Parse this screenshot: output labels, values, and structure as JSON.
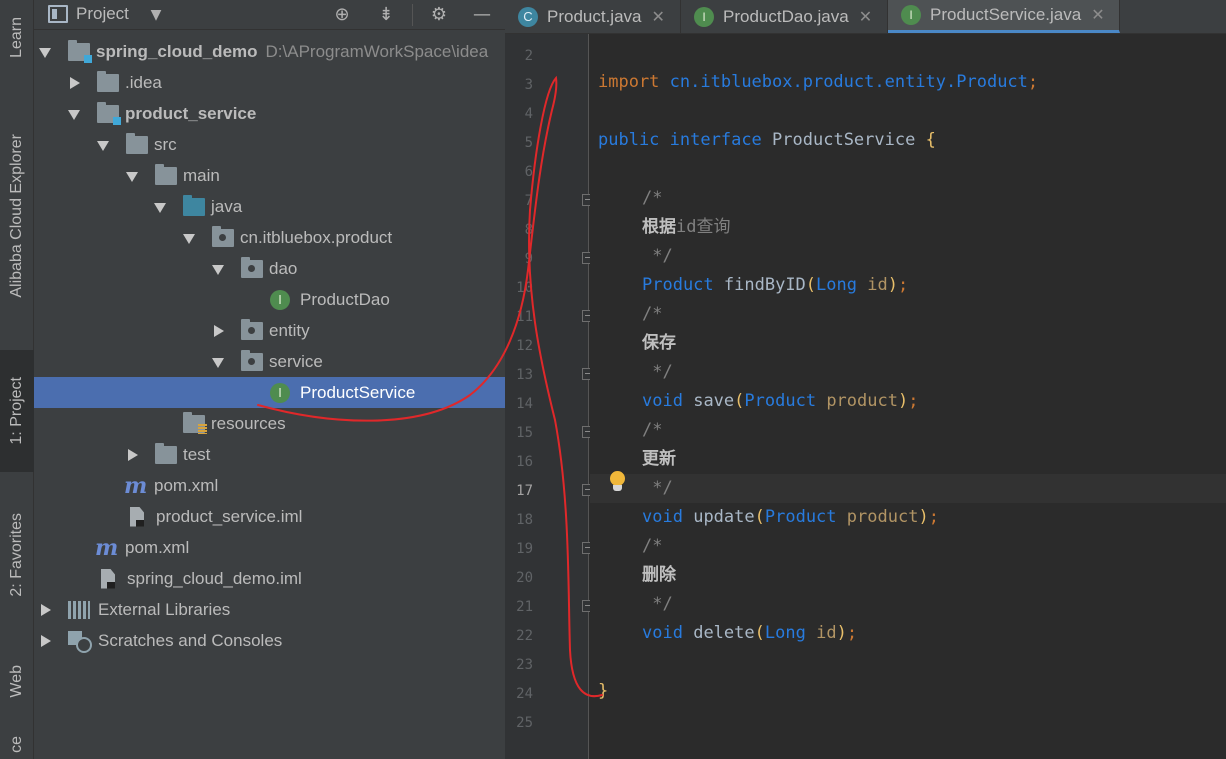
{
  "toolstrip": {
    "learn": "Learn",
    "cloud_explorer": "Alibaba Cloud Explorer",
    "project": "1: Project",
    "favorites": "2: Favorites",
    "web": "Web",
    "bottom_cut": "ce"
  },
  "project_panel": {
    "title": "Project",
    "tree": [
      {
        "label": "spring_cloud_demo",
        "path": "D:\\AProgramWorkSpace\\idea"
      },
      {
        "label": ".idea"
      },
      {
        "label": "product_service"
      },
      {
        "label": "src"
      },
      {
        "label": "main"
      },
      {
        "label": "java"
      },
      {
        "label": "cn.itbluebox.product"
      },
      {
        "label": "dao"
      },
      {
        "label": "ProductDao"
      },
      {
        "label": "entity"
      },
      {
        "label": "service"
      },
      {
        "label": "ProductService"
      },
      {
        "label": "resources"
      },
      {
        "label": "test"
      },
      {
        "label": "pom.xml"
      },
      {
        "label": "product_service.iml"
      },
      {
        "label": "pom.xml"
      },
      {
        "label": "spring_cloud_demo.iml"
      },
      {
        "label": "External Libraries"
      },
      {
        "label": "Scratches and Consoles"
      }
    ]
  },
  "tabs": [
    {
      "label": "Product.java",
      "icon": "C"
    },
    {
      "label": "ProductDao.java",
      "icon": "I"
    },
    {
      "label": "ProductService.java",
      "icon": "I"
    }
  ],
  "editor": {
    "line_numbers": [
      "2",
      "3",
      "4",
      "5",
      "6",
      "7",
      "8",
      "9",
      "10",
      "11",
      "12",
      "13",
      "14",
      "15",
      "16",
      "17",
      "18",
      "19",
      "20",
      "21",
      "22",
      "23",
      "24",
      "25"
    ],
    "current_line": "17",
    "code": {
      "import_kw": "import",
      "import_path": "cn.itbluebox.product.entity.",
      "import_cls": "Product",
      "semi": ";",
      "public_kw": "public",
      "interface_kw": "interface",
      "iface_name": "ProductService",
      "open_brace": "{",
      "close_brace": "}",
      "c_open": "/*",
      "c_close": " */",
      "c1": "根据",
      "c1b": "id查询",
      "c2": "保存",
      "c3": "更新",
      "c4": "删除",
      "m1_type": "Product",
      "m1_name": "findByID",
      "m1_ptype": "Long",
      "m1_pname": "id",
      "void_kw": "void",
      "m2_name": "save",
      "m2_ptype": "Product",
      "m2_pname": "product",
      "m3_name": "update",
      "m3_ptype": "Product",
      "m3_pname": "product",
      "m4_name": "delete",
      "m4_ptype": "Long",
      "m4_pname": "id",
      "lparen": "(",
      "rparen": ")"
    }
  },
  "colors": {
    "selection": "#4b6eaf",
    "keyword": "#cc7832",
    "annotation_stroke": "#e0282a"
  }
}
